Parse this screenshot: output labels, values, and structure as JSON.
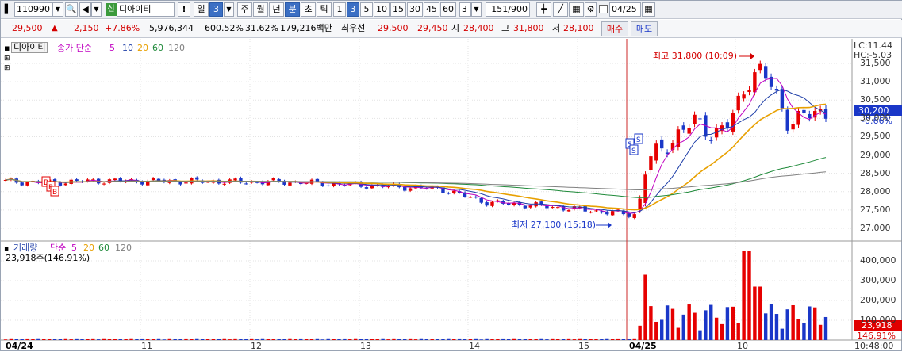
{
  "toolbar": {
    "code": "110990",
    "badge": "신",
    "stock_name": "디아이티",
    "excl": "!",
    "day": "일",
    "count_sel": "3",
    "week": "주",
    "month": "월",
    "year": "년",
    "minute": "분",
    "second": "초",
    "tick": "틱",
    "intervals": [
      "1",
      "3",
      "5",
      "10",
      "15",
      "30",
      "45",
      "60"
    ],
    "interval_input": "3",
    "bars": "151/900",
    "date_label": "04/25"
  },
  "quote": {
    "price": "29,500",
    "up_arrow": "▲",
    "change": "2,150",
    "change_pct": "+7.86%",
    "volume": "5,976,344",
    "volume_ratio": "600.52%",
    "turnover": "31.62%",
    "amount": "179,216백만",
    "best_label": "최우선",
    "best_ask": "29,500",
    "best_bid": "29,450",
    "open_label": "시",
    "open": "28,400",
    "high_label": "고",
    "high": "31,800",
    "low_label": "저",
    "low": "28,100",
    "buy_btn": "매수",
    "sell_btn": "매도"
  },
  "colors": {
    "up": "#e60000",
    "down": "#1a37c8",
    "ma5": "#c000c0",
    "ma10": "#1f3fa8",
    "ma20": "#e8a000",
    "ma60": "#1f8a3a",
    "ma120": "#808080"
  },
  "price_pane": {
    "stock": "디아이티",
    "legend_prefix": "종가 단순",
    "ma": [
      "5",
      "10",
      "20",
      "60",
      "120"
    ],
    "lc": "LC:11.44",
    "hc": "HC:-5.03",
    "high_annot": "최고 31,800 (10:09)",
    "low_annot": "최저 27,100 (15:18)",
    "cur_price": "30,200",
    "cur_pct": "-0.66%",
    "axis": [
      "31,500",
      "31,000",
      "30,500",
      "30,000",
      "29,500",
      "29,000",
      "28,500",
      "28,000",
      "27,500",
      "27,000"
    ]
  },
  "volume_pane": {
    "title": "거래량",
    "legend_prefix": "단순",
    "ma": [
      "5",
      "20",
      "60",
      "120"
    ],
    "last_value": "23,918주(146.91%)",
    "cur_vol": "23,918",
    "cur_pct": "146.91%",
    "axis": [
      "400,000",
      "300,000",
      "200,000",
      "100,000"
    ]
  },
  "x_axis": {
    "labels": [
      "04/24",
      "11",
      "12",
      "13",
      "14",
      "15",
      "04/25",
      "10"
    ],
    "time": "10:48:00"
  }
}
